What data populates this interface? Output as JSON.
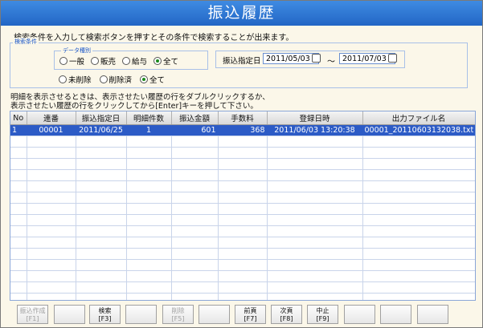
{
  "window": {
    "title": "振込履歴"
  },
  "instruction": "検索条件を入力して検索ボタンを押すとその条件で検索することが出来ます。",
  "search": {
    "legend": "検索条件",
    "data_type": {
      "legend": "データ種別",
      "options": [
        "一般",
        "販売",
        "給与",
        "全て"
      ],
      "selected": "全て"
    },
    "delete_status": {
      "options": [
        "未削除",
        "削除済",
        "全て"
      ],
      "selected": "全て"
    },
    "date_range": {
      "label": "振込指定日",
      "from": "2011/05/03",
      "separator": "～",
      "to": "2011/07/03"
    }
  },
  "notes": [
    "明細を表示させるときは、表示させたい履歴の行をダブルクリックするか、",
    "表示させたい履歴の行をクリックしてから[Enter]キーを押して下さい。"
  ],
  "table": {
    "columns": [
      "No",
      "連番",
      "振込指定日",
      "明細件数",
      "振込金額",
      "手数料",
      "登録日時",
      "出力ファイル名"
    ],
    "rows": [
      [
        "1",
        "00001",
        "2011/06/25",
        "1",
        "601",
        "368",
        "2011/06/03 13:20:38",
        "00001_20110603132038.txt"
      ]
    ]
  },
  "buttons": [
    {
      "name": "振込作成",
      "key": "[F1]",
      "enabled": false
    },
    {
      "name": "",
      "key": "",
      "enabled": false
    },
    {
      "name": "検索",
      "key": "[F3]",
      "enabled": true
    },
    {
      "name": "",
      "key": "",
      "enabled": false
    },
    {
      "name": "削除",
      "key": "[F5]",
      "enabled": false
    },
    {
      "name": "",
      "key": "",
      "enabled": false
    },
    {
      "name": "前頁",
      "key": "[F7]",
      "enabled": true
    },
    {
      "name": "次頁",
      "key": "[F8]",
      "enabled": true
    },
    {
      "name": "中止",
      "key": "[F9]",
      "enabled": true
    },
    {
      "name": "",
      "key": "",
      "enabled": false
    },
    {
      "name": "",
      "key": "",
      "enabled": false
    },
    {
      "name": "",
      "key": "",
      "enabled": false
    }
  ]
}
